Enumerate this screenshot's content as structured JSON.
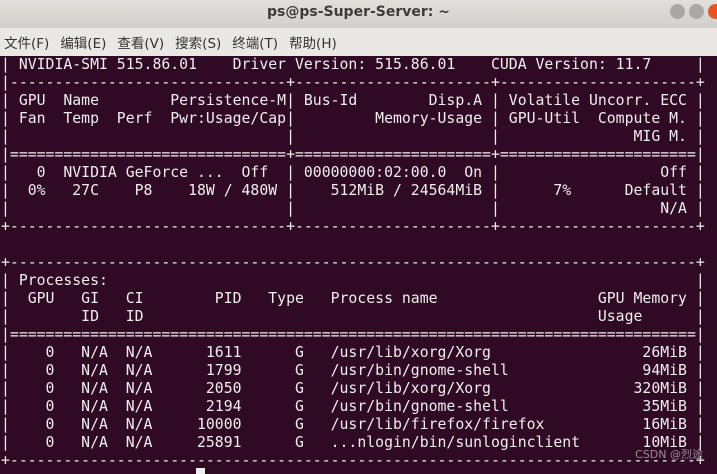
{
  "window": {
    "title": "ps@ps-Super-Server: ~"
  },
  "menu": [
    "文件(F)",
    "编辑(E)",
    "查看(V)",
    "搜索(S)",
    "终端(T)",
    "帮助(H)"
  ],
  "terminal_lines": [
    "| NVIDIA-SMI 515.86.01    Driver Version: 515.86.01    CUDA Version: 11.7     |",
    "|-------------------------------+----------------------+----------------------+",
    "| GPU  Name        Persistence-M| Bus-Id        Disp.A | Volatile Uncorr. ECC |",
    "| Fan  Temp  Perf  Pwr:Usage/Cap|         Memory-Usage | GPU-Util  Compute M. |",
    "|                               |                      |               MIG M. |",
    "|===============================+======================+======================|",
    "|   0  NVIDIA GeForce ...  Off  | 00000000:02:00.0  On |                  Off |",
    "|  0%   27C    P8    18W / 480W |    512MiB / 24564MiB |      7%      Default |",
    "|                               |                      |                  N/A |",
    "+-------------------------------+----------------------+----------------------+",
    "",
    "+-----------------------------------------------------------------------------+",
    "| Processes:                                                                  |",
    "|  GPU   GI   CI        PID   Type   Process name                  GPU Memory |",
    "|        ID   ID                                                   Usage      |",
    "|=============================================================================|",
    "|    0   N/A  N/A      1611      G   /usr/lib/xorg/Xorg                 26MiB |",
    "|    0   N/A  N/A      1799      G   /usr/bin/gnome-shell               94MiB |",
    "|    0   N/A  N/A      2050      G   /usr/lib/xorg/Xorg                320MiB |",
    "|    0   N/A  N/A      2194      G   /usr/bin/gnome-shell               35MiB |",
    "|    0   N/A  N/A     10000      G   /usr/lib/firefox/firefox           16MiB |",
    "|    0   N/A  N/A     25891      G   ...nlogin/bin/sunloginclient       10MiB |",
    "+-----------------------------------------------------------------------------+"
  ],
  "watermark": "CSDN @烈途"
}
